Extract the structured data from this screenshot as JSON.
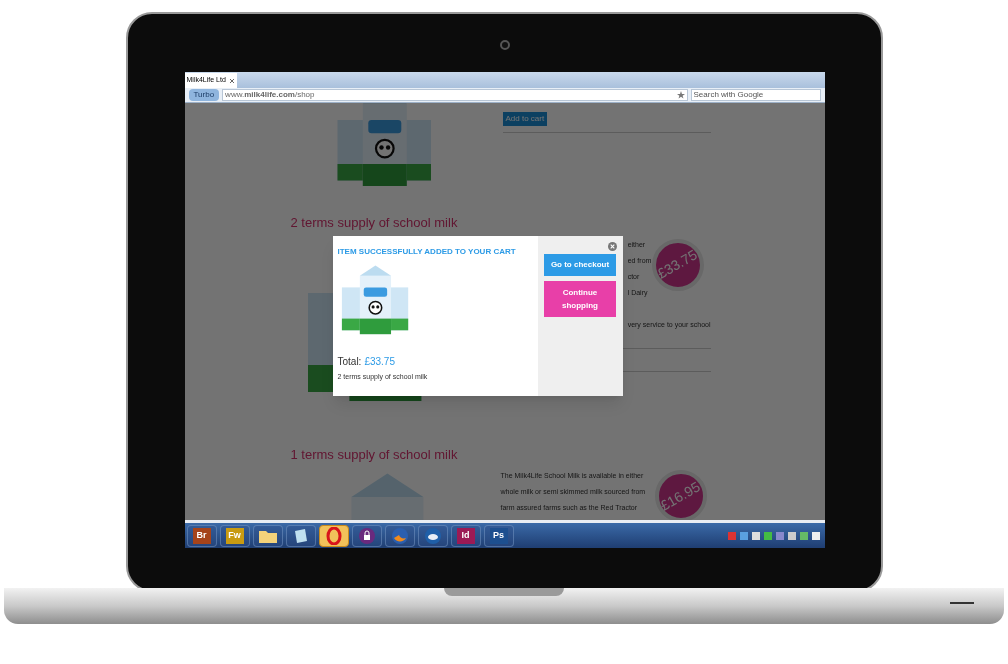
{
  "browser": {
    "tab": "Milk4Life Ltd",
    "turbo": "Turbo",
    "url": "www.**milk4life.com**/shop",
    "search_placeholder": "Search with Google"
  },
  "page": {
    "top_button": "Add to cart",
    "products": [
      {
        "title": "2 terms supply of school milk",
        "description_lines": [
          "either",
          "ed from",
          "ctor",
          "l Dairy"
        ],
        "note": "very service to your school",
        "price": "£33.75",
        "kind": "behind_dialog"
      },
      {
        "title": "1 terms supply of school milk",
        "description_lines": [
          "The Milk4Life School Milk is available in either",
          "whole milk or semi skimmed milk sourced from",
          "farm assured farms such as the Red Tractor"
        ],
        "price": "£16.95",
        "kind": "plain"
      }
    ]
  },
  "modal": {
    "title": "ITEM SUCCESSFULLY ADDED TO YOUR CART",
    "total_label": "Total:",
    "total": "£33.75",
    "product": "2 terms supply of school milk",
    "checkout_button": "Go to checkout",
    "continue_button": "Continue shopping"
  },
  "taskbar": {
    "apps": [
      {
        "kind": "label",
        "label": "Br",
        "color": "#a5431a",
        "selected": false
      },
      {
        "kind": "label",
        "label": "Fw",
        "color": "#c89b12",
        "selected": false
      },
      {
        "kind": "folder",
        "selected": false
      },
      {
        "kind": "notes",
        "selected": false
      },
      {
        "kind": "ring",
        "selected": true
      },
      {
        "kind": "lock",
        "selected": false
      },
      {
        "kind": "globe",
        "selected": false
      },
      {
        "kind": "bird",
        "selected": false
      },
      {
        "kind": "label",
        "label": "Id",
        "color": "#9c1a55",
        "selected": false
      },
      {
        "kind": "label",
        "label": "Ps",
        "color": "#1d4f8f",
        "selected": false
      }
    ]
  }
}
